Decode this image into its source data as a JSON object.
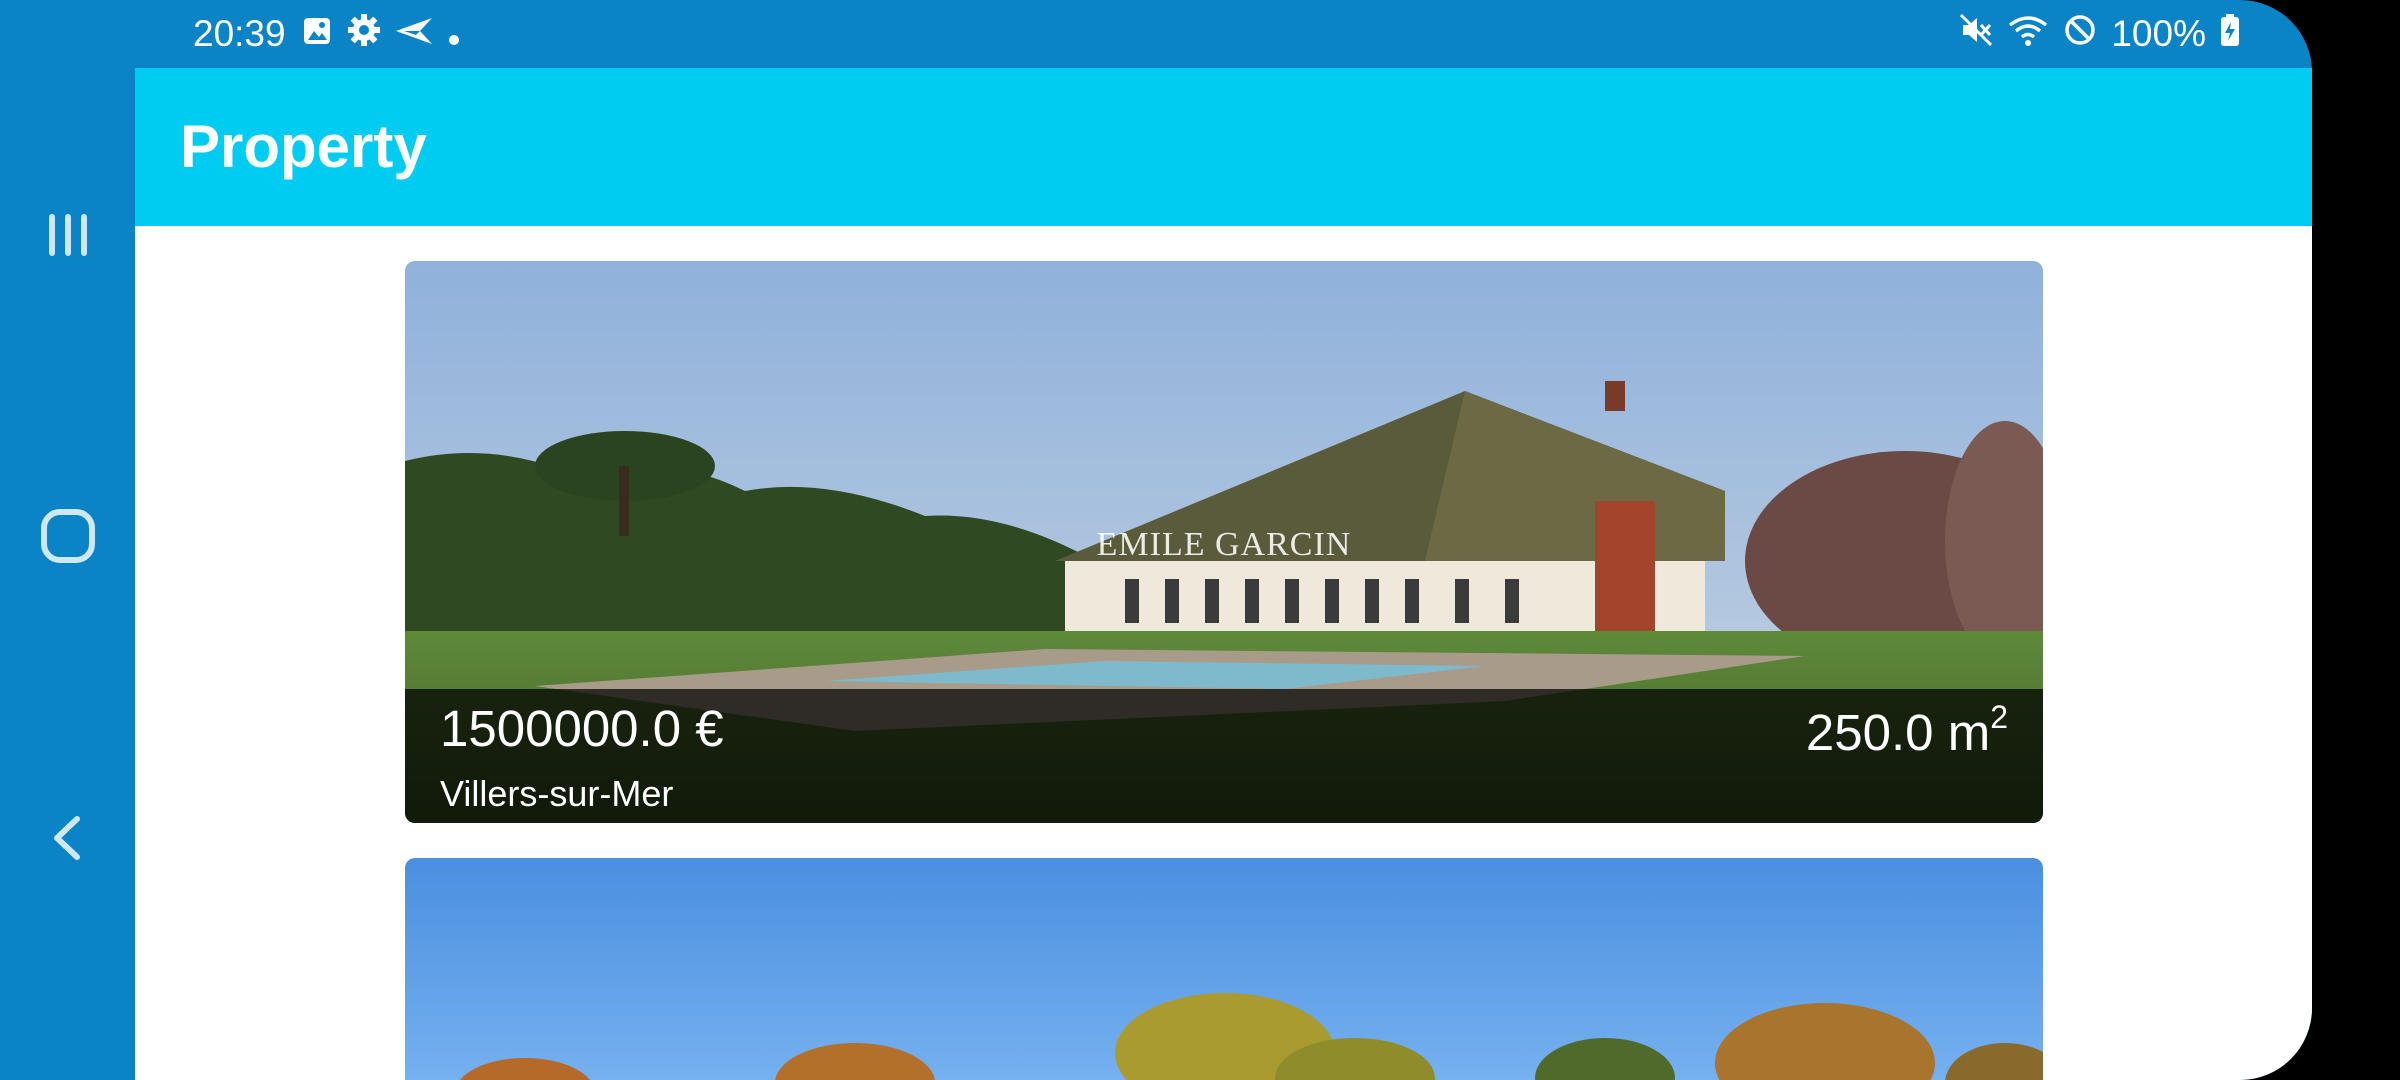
{
  "status_bar": {
    "time": "20:39",
    "battery": "100%",
    "left_icons": [
      "gallery-icon",
      "settings-icon",
      "send-icon",
      "dot-icon"
    ],
    "right_icons": [
      "mute-icon",
      "wifi-icon",
      "do-not-disturb-icon",
      "battery-charging-icon"
    ]
  },
  "navigation": {
    "buttons": [
      "recents-icon",
      "home-icon",
      "back-icon"
    ]
  },
  "app_bar": {
    "title": "Property"
  },
  "listings": [
    {
      "price": "1500000.0 €",
      "city": "Villers-sur-Mer",
      "area": "250.0 m",
      "area_exponent": "2",
      "watermark": "EMILE GARCIN"
    }
  ],
  "colors": {
    "system_bar": "#0a84c6",
    "app_bar": "#00cbf0",
    "background": "#ffffff",
    "overlay": "#000000"
  }
}
